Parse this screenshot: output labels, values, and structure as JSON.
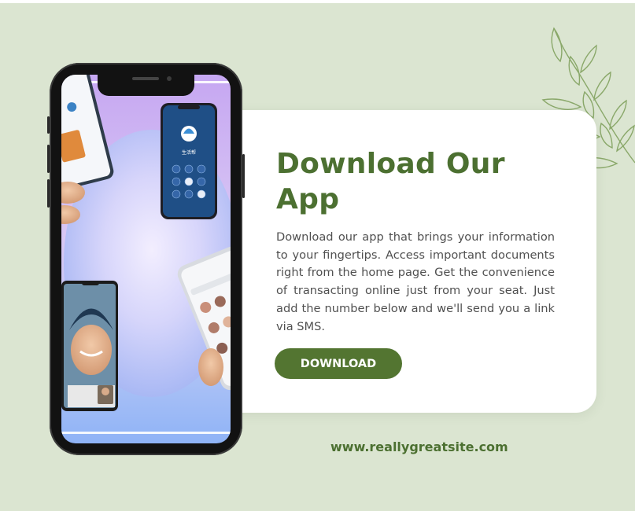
{
  "promo": {
    "title": "Download Our App",
    "description": "Download our app that brings your information to your fingertips. Access important documents right from the home page. Get the convenience of transacting online just from your seat. Just add the number below and we'll send you a link via SMS.",
    "button_label": "DOWNLOAD",
    "website": "www.reallygreatsite.com"
  },
  "app_screen": {
    "app_name": "生活帮"
  },
  "colors": {
    "background": "#dbe5d1",
    "card": "#ffffff",
    "accent_green": "#4c7031",
    "button_green": "#537531",
    "body_text": "#505050",
    "leaf_stroke": "#8aa86a"
  },
  "icons": [
    "leaf-branch-icon",
    "phone-mockup-image"
  ]
}
